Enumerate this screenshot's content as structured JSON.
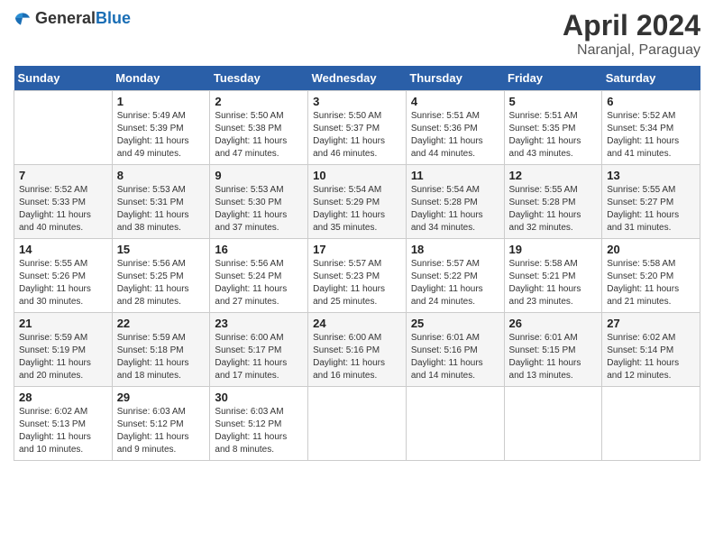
{
  "header": {
    "logo_general": "General",
    "logo_blue": "Blue",
    "month_title": "April 2024",
    "location": "Naranjal, Paraguay"
  },
  "days_of_week": [
    "Sunday",
    "Monday",
    "Tuesday",
    "Wednesday",
    "Thursday",
    "Friday",
    "Saturday"
  ],
  "weeks": [
    [
      {
        "day": "",
        "sunrise": "",
        "sunset": "",
        "daylight": ""
      },
      {
        "day": "1",
        "sunrise": "Sunrise: 5:49 AM",
        "sunset": "Sunset: 5:39 PM",
        "daylight": "Daylight: 11 hours and 49 minutes."
      },
      {
        "day": "2",
        "sunrise": "Sunrise: 5:50 AM",
        "sunset": "Sunset: 5:38 PM",
        "daylight": "Daylight: 11 hours and 47 minutes."
      },
      {
        "day": "3",
        "sunrise": "Sunrise: 5:50 AM",
        "sunset": "Sunset: 5:37 PM",
        "daylight": "Daylight: 11 hours and 46 minutes."
      },
      {
        "day": "4",
        "sunrise": "Sunrise: 5:51 AM",
        "sunset": "Sunset: 5:36 PM",
        "daylight": "Daylight: 11 hours and 44 minutes."
      },
      {
        "day": "5",
        "sunrise": "Sunrise: 5:51 AM",
        "sunset": "Sunset: 5:35 PM",
        "daylight": "Daylight: 11 hours and 43 minutes."
      },
      {
        "day": "6",
        "sunrise": "Sunrise: 5:52 AM",
        "sunset": "Sunset: 5:34 PM",
        "daylight": "Daylight: 11 hours and 41 minutes."
      }
    ],
    [
      {
        "day": "7",
        "sunrise": "Sunrise: 5:52 AM",
        "sunset": "Sunset: 5:33 PM",
        "daylight": "Daylight: 11 hours and 40 minutes."
      },
      {
        "day": "8",
        "sunrise": "Sunrise: 5:53 AM",
        "sunset": "Sunset: 5:31 PM",
        "daylight": "Daylight: 11 hours and 38 minutes."
      },
      {
        "day": "9",
        "sunrise": "Sunrise: 5:53 AM",
        "sunset": "Sunset: 5:30 PM",
        "daylight": "Daylight: 11 hours and 37 minutes."
      },
      {
        "day": "10",
        "sunrise": "Sunrise: 5:54 AM",
        "sunset": "Sunset: 5:29 PM",
        "daylight": "Daylight: 11 hours and 35 minutes."
      },
      {
        "day": "11",
        "sunrise": "Sunrise: 5:54 AM",
        "sunset": "Sunset: 5:28 PM",
        "daylight": "Daylight: 11 hours and 34 minutes."
      },
      {
        "day": "12",
        "sunrise": "Sunrise: 5:55 AM",
        "sunset": "Sunset: 5:28 PM",
        "daylight": "Daylight: 11 hours and 32 minutes."
      },
      {
        "day": "13",
        "sunrise": "Sunrise: 5:55 AM",
        "sunset": "Sunset: 5:27 PM",
        "daylight": "Daylight: 11 hours and 31 minutes."
      }
    ],
    [
      {
        "day": "14",
        "sunrise": "Sunrise: 5:55 AM",
        "sunset": "Sunset: 5:26 PM",
        "daylight": "Daylight: 11 hours and 30 minutes."
      },
      {
        "day": "15",
        "sunrise": "Sunrise: 5:56 AM",
        "sunset": "Sunset: 5:25 PM",
        "daylight": "Daylight: 11 hours and 28 minutes."
      },
      {
        "day": "16",
        "sunrise": "Sunrise: 5:56 AM",
        "sunset": "Sunset: 5:24 PM",
        "daylight": "Daylight: 11 hours and 27 minutes."
      },
      {
        "day": "17",
        "sunrise": "Sunrise: 5:57 AM",
        "sunset": "Sunset: 5:23 PM",
        "daylight": "Daylight: 11 hours and 25 minutes."
      },
      {
        "day": "18",
        "sunrise": "Sunrise: 5:57 AM",
        "sunset": "Sunset: 5:22 PM",
        "daylight": "Daylight: 11 hours and 24 minutes."
      },
      {
        "day": "19",
        "sunrise": "Sunrise: 5:58 AM",
        "sunset": "Sunset: 5:21 PM",
        "daylight": "Daylight: 11 hours and 23 minutes."
      },
      {
        "day": "20",
        "sunrise": "Sunrise: 5:58 AM",
        "sunset": "Sunset: 5:20 PM",
        "daylight": "Daylight: 11 hours and 21 minutes."
      }
    ],
    [
      {
        "day": "21",
        "sunrise": "Sunrise: 5:59 AM",
        "sunset": "Sunset: 5:19 PM",
        "daylight": "Daylight: 11 hours and 20 minutes."
      },
      {
        "day": "22",
        "sunrise": "Sunrise: 5:59 AM",
        "sunset": "Sunset: 5:18 PM",
        "daylight": "Daylight: 11 hours and 18 minutes."
      },
      {
        "day": "23",
        "sunrise": "Sunrise: 6:00 AM",
        "sunset": "Sunset: 5:17 PM",
        "daylight": "Daylight: 11 hours and 17 minutes."
      },
      {
        "day": "24",
        "sunrise": "Sunrise: 6:00 AM",
        "sunset": "Sunset: 5:16 PM",
        "daylight": "Daylight: 11 hours and 16 minutes."
      },
      {
        "day": "25",
        "sunrise": "Sunrise: 6:01 AM",
        "sunset": "Sunset: 5:16 PM",
        "daylight": "Daylight: 11 hours and 14 minutes."
      },
      {
        "day": "26",
        "sunrise": "Sunrise: 6:01 AM",
        "sunset": "Sunset: 5:15 PM",
        "daylight": "Daylight: 11 hours and 13 minutes."
      },
      {
        "day": "27",
        "sunrise": "Sunrise: 6:02 AM",
        "sunset": "Sunset: 5:14 PM",
        "daylight": "Daylight: 11 hours and 12 minutes."
      }
    ],
    [
      {
        "day": "28",
        "sunrise": "Sunrise: 6:02 AM",
        "sunset": "Sunset: 5:13 PM",
        "daylight": "Daylight: 11 hours and 10 minutes."
      },
      {
        "day": "29",
        "sunrise": "Sunrise: 6:03 AM",
        "sunset": "Sunset: 5:12 PM",
        "daylight": "Daylight: 11 hours and 9 minutes."
      },
      {
        "day": "30",
        "sunrise": "Sunrise: 6:03 AM",
        "sunset": "Sunset: 5:12 PM",
        "daylight": "Daylight: 11 hours and 8 minutes."
      },
      {
        "day": "",
        "sunrise": "",
        "sunset": "",
        "daylight": ""
      },
      {
        "day": "",
        "sunrise": "",
        "sunset": "",
        "daylight": ""
      },
      {
        "day": "",
        "sunrise": "",
        "sunset": "",
        "daylight": ""
      },
      {
        "day": "",
        "sunrise": "",
        "sunset": "",
        "daylight": ""
      }
    ]
  ]
}
